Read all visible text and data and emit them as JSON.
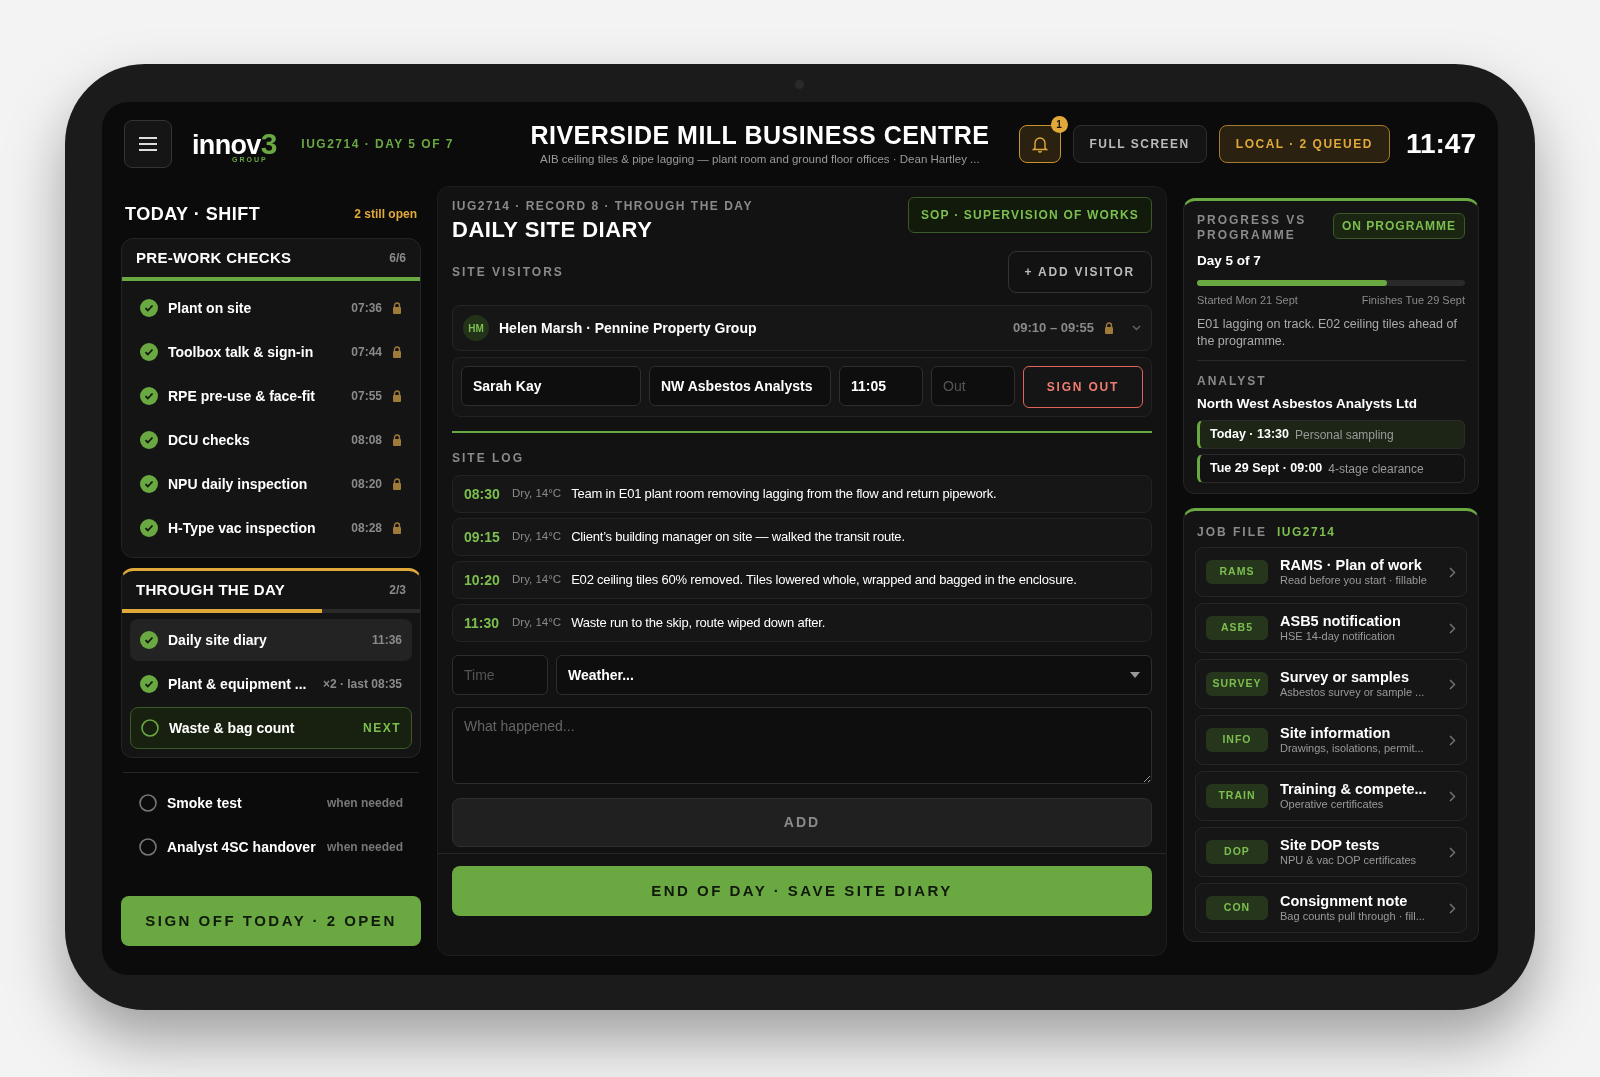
{
  "header": {
    "logo": {
      "word": "innov",
      "mark": "3",
      "sub": "GROUP"
    },
    "job": "IUG2714 · DAY 5 OF 7",
    "title": "RIVERSIDE MILL BUSINESS CENTRE",
    "subtitle": "AIB ceiling tiles & pipe lagging — plant room and ground floor offices · Dean Hartley ...",
    "notifications": "1",
    "fullscreen": "FULL SCREEN",
    "sync": "LOCAL · 2 QUEUED",
    "clock": "11:47"
  },
  "shift": {
    "title": "TODAY · SHIFT",
    "open_note": "2 still open",
    "sections": [
      {
        "title": "PRE-WORK CHECKS",
        "count": "6/6",
        "color": "#6aa842",
        "level": 1,
        "items": [
          {
            "label": "Plant on site",
            "meta": "07:36",
            "kind": "done",
            "locked": true,
            "selected": false
          },
          {
            "label": "Toolbox talk & sign-in",
            "meta": "07:44",
            "kind": "done",
            "locked": true,
            "selected": false
          },
          {
            "label": "RPE pre-use & face-fit",
            "meta": "07:55",
            "kind": "done",
            "locked": true,
            "selected": false
          },
          {
            "label": "DCU checks",
            "meta": "08:08",
            "kind": "done",
            "locked": true,
            "selected": false
          },
          {
            "label": "NPU daily inspection",
            "meta": "08:20",
            "kind": "done",
            "locked": true,
            "selected": false
          },
          {
            "label": "H-Type vac inspection",
            "meta": "08:28",
            "kind": "done",
            "locked": true,
            "selected": false
          }
        ]
      },
      {
        "title": "THROUGH THE DAY",
        "count": "2/3",
        "color": "#e0a93a",
        "level": 0.67,
        "items": [
          {
            "label": "Daily site diary",
            "meta": "11:36",
            "kind": "done",
            "locked": false,
            "selected": true
          },
          {
            "label": "Plant & equipment ...",
            "meta": "×2 · last 08:35",
            "kind": "done",
            "locked": false,
            "selected": false
          },
          {
            "label": "Waste & bag count",
            "meta": "NEXT",
            "kind": "next",
            "locked": false,
            "selected": false
          }
        ]
      }
    ],
    "optional": [
      {
        "label": "Smoke test",
        "meta": "when needed"
      },
      {
        "label": "Analyst 4SC handover",
        "meta": "when needed"
      }
    ],
    "sign_off": "SIGN OFF TODAY · 2 OPEN"
  },
  "diary": {
    "breadcrumb": "IUG2714 · RECORD 8 · THROUGH THE DAY",
    "title": "DAILY SITE DIARY",
    "sop": "SOP · SUPERVISION OF WORKS",
    "visitors": {
      "label": "SITE VISITORS",
      "add": "+ ADD VISITOR",
      "entries": [
        {
          "initials": "HM",
          "name": "Helen Marsh · Pennine Property Group",
          "times": "09:10 – 09:55",
          "locked": true
        }
      ],
      "new": {
        "name": "Sarah Kay",
        "company": "NW Asbestos Analysts",
        "time_in": "11:05",
        "time_out_placeholder": "Out",
        "sign_out": "SIGN OUT"
      }
    },
    "log": {
      "label": "SITE LOG",
      "entries": [
        {
          "time": "08:30",
          "weather": "Dry, 14°C",
          "text": "Team in E01 plant room removing lagging from the flow and return pipework."
        },
        {
          "time": "09:15",
          "weather": "Dry, 14°C",
          "text": "Client’s building manager on site — walked the transit route."
        },
        {
          "time": "10:20",
          "weather": "Dry, 14°C",
          "text": "E02 ceiling tiles 60% removed. Tiles lowered whole, wrapped and bagged in the enclosure."
        },
        {
          "time": "11:30",
          "weather": "Dry, 14°C",
          "text": "Waste run to the skip, route wiped down after."
        }
      ]
    },
    "form": {
      "time_placeholder": "Time",
      "weather": "Weather...",
      "note_placeholder": "What happened...",
      "add": "ADD"
    },
    "save": "END OF DAY · SAVE SITE DIARY"
  },
  "progress": {
    "label": "PROGRESS VS PROGRAMME",
    "status": "ON PROGRAMME",
    "day": "Day 5 of 7",
    "level": 0.71,
    "start": "Started Mon 21 Sept",
    "finish": "Finishes Tue 29 Sept",
    "note": "E01 lagging on track. E02 ceiling tiles ahead of the programme.",
    "analyst": {
      "label": "ANALYST",
      "name": "North West Asbestos Analysts Ltd",
      "visits": [
        {
          "when": "Today · 13:30",
          "what": "Personal sampling",
          "selected": true
        },
        {
          "when": "Tue 29 Sept · 09:00",
          "what": "4-stage clearance",
          "selected": false
        }
      ]
    }
  },
  "job_file": {
    "label": "JOB FILE",
    "code": "IUG2714",
    "docs": [
      {
        "tag": "RAMS",
        "title": "RAMS · Plan of work",
        "subtitle": "Read before you start · fillable"
      },
      {
        "tag": "ASB5",
        "title": "ASB5 notification",
        "subtitle": "HSE 14-day notification"
      },
      {
        "tag": "SURVEY",
        "title": "Survey or samples",
        "subtitle": "Asbestos survey or sample ..."
      },
      {
        "tag": "INFO",
        "title": "Site information",
        "subtitle": "Drawings, isolations, permit..."
      },
      {
        "tag": "TRAIN",
        "title": "Training & compete...",
        "subtitle": "Operative certificates"
      },
      {
        "tag": "DOP",
        "title": "Site DOP tests",
        "subtitle": "NPU & vac DOP certificates"
      },
      {
        "tag": "CON",
        "title": "Consignment note",
        "subtitle": "Bag counts pull through · fill..."
      }
    ]
  }
}
